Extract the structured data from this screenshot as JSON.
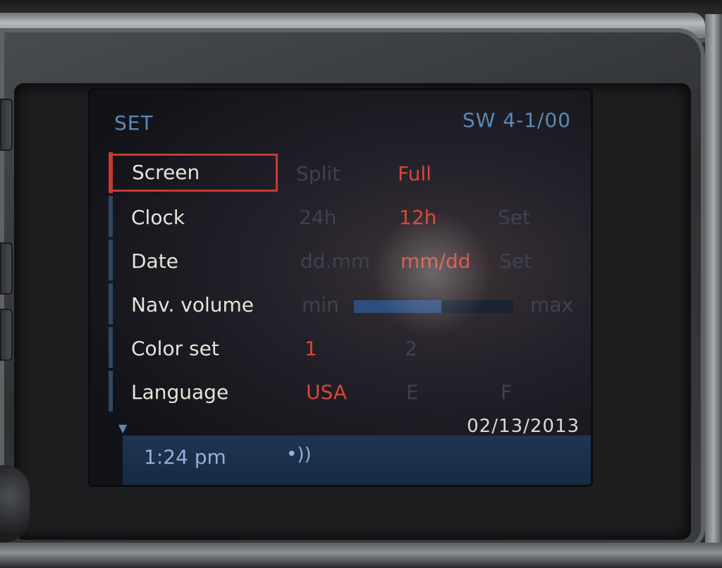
{
  "screen": {
    "title": "SET",
    "version": "SW 4-1/00",
    "date": "02/13/2013",
    "time": "1:24 pm"
  },
  "menu": [
    {
      "label": "Screen",
      "selected": true,
      "options": [
        {
          "text": "Split",
          "active": false
        },
        {
          "text": "Full",
          "active": true
        }
      ]
    },
    {
      "label": "Clock",
      "options": [
        {
          "text": "24h",
          "active": false
        },
        {
          "text": "12h",
          "active": true
        },
        {
          "text": "Set",
          "active": false
        }
      ]
    },
    {
      "label": "Date",
      "options": [
        {
          "text": "dd.mm",
          "active": false
        },
        {
          "text": "mm/dd",
          "active": true
        },
        {
          "text": "Set",
          "active": false
        }
      ]
    },
    {
      "label": "Nav. volume",
      "min_label": "min",
      "max_label": "max",
      "level": 0.55
    },
    {
      "label": "Color set",
      "options": [
        {
          "text": "1",
          "active": true
        },
        {
          "text": "2",
          "active": false
        }
      ]
    },
    {
      "label": "Language",
      "options": [
        {
          "text": "USA",
          "active": true
        },
        {
          "text": "E",
          "active": false
        },
        {
          "text": "F",
          "active": false
        }
      ]
    }
  ],
  "icons": {
    "scroll": "scroll-down-arrow-icon",
    "sound": "sound-waves-icon"
  },
  "colors": {
    "accent_blue": "#5c88b8",
    "selection_red": "#c43b34",
    "active_option": "#d84639",
    "dim_option": "#3c4352"
  }
}
